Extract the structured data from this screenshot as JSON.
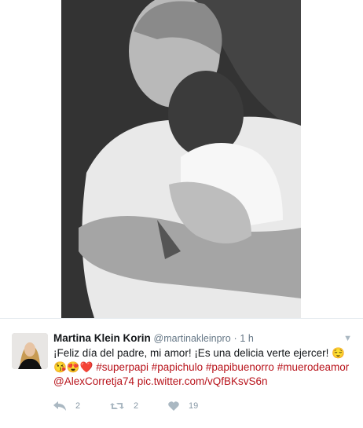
{
  "tweet": {
    "display_name": "Martina Klein Korin",
    "handle": "@martinakleinpro",
    "separator": "·",
    "time": "1 h",
    "text_line1": "¡Feliz día del padre, mi amor! ¡Es una delicia verte ejercer!",
    "emoji_line1": "😌",
    "emoji_line2": "😘😍❤️",
    "hashtags": [
      "#superpapi",
      "#papichulo",
      "#papibuenorro",
      "#muerodeamor"
    ],
    "mention": "@AlexCorretja74",
    "link": "pic.twitter.com/vQfBKsvS6n",
    "counts": {
      "reply": "2",
      "retweet": "2",
      "like": "19"
    }
  },
  "colors": {
    "hashtag": "#b8131b",
    "meta": "#657786",
    "icon": "#aab8c2"
  },
  "icons": [
    "reply-icon",
    "retweet-icon",
    "like-icon",
    "chevron-down-icon"
  ]
}
